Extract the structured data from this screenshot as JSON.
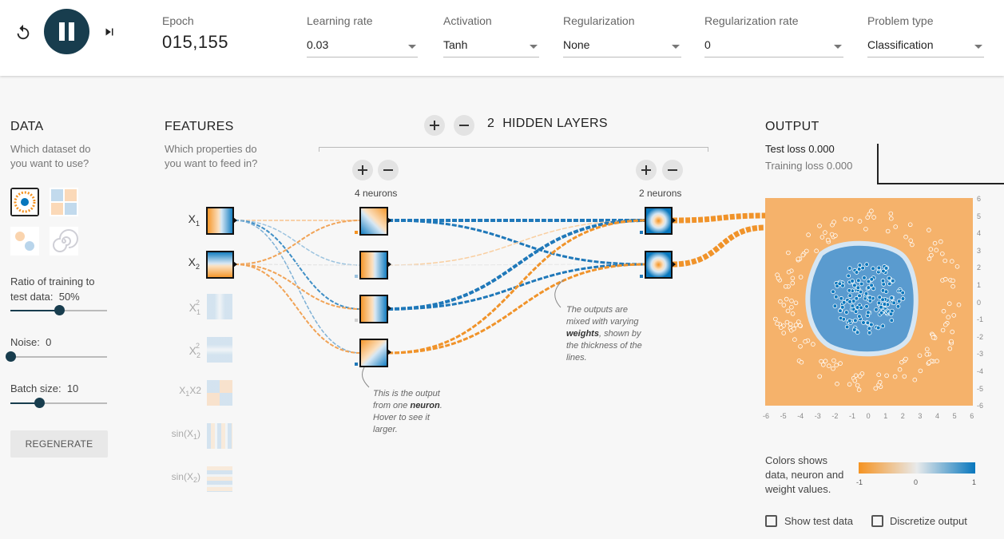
{
  "controls": {
    "reset": "reset-icon",
    "play": "pause-icon",
    "step": "step-forward-icon"
  },
  "epoch": {
    "label": "Epoch",
    "value": "015,155"
  },
  "selects": [
    {
      "label": "Learning rate",
      "value": "0.03"
    },
    {
      "label": "Activation",
      "value": "Tanh"
    },
    {
      "label": "Regularization",
      "value": "None"
    },
    {
      "label": "Regularization rate",
      "value": "0"
    },
    {
      "label": "Problem type",
      "value": "Classification"
    }
  ],
  "data": {
    "title": "DATA",
    "subtitle": "Which dataset do you want to use?",
    "datasets": [
      "circle",
      "xor",
      "gaussian",
      "spiral"
    ],
    "ratio_label": "Ratio of training to test data:",
    "ratio_value": "50%",
    "ratio_level": 0.5,
    "noise_label": "Noise:",
    "noise_value": "0",
    "noise_level": 0,
    "batch_label": "Batch size:",
    "batch_value": "10",
    "batch_level": 0.3,
    "regenerate": "REGENERATE"
  },
  "features": {
    "title": "FEATURES",
    "subtitle": "Which properties do you want to feed in?",
    "items": [
      {
        "base": "X",
        "sub": "1",
        "sup": "",
        "suffix": "",
        "active": true
      },
      {
        "base": "X",
        "sub": "2",
        "sup": "",
        "suffix": "",
        "active": true
      },
      {
        "base": "X",
        "sub": "1",
        "sup": "2",
        "suffix": "",
        "active": false
      },
      {
        "base": "X",
        "sub": "2",
        "sup": "2",
        "suffix": "",
        "active": false
      },
      {
        "base": "X",
        "sub": "1",
        "sup": "",
        "suffix": "X2",
        "active": false
      },
      {
        "base": "sin(X",
        "sub": "1",
        "sup": "",
        "suffix": ")",
        "active": false
      },
      {
        "base": "sin(X",
        "sub": "2",
        "sup": "",
        "suffix": ")",
        "active": false
      }
    ]
  },
  "hidden": {
    "count": "2",
    "label": "HIDDEN LAYERS",
    "layer1_neurons": "4 neurons",
    "layer2_neurons": "2 neurons"
  },
  "annotations": {
    "neuron_pre": "This is the output from one ",
    "neuron_bold": "neuron",
    "neuron_post": ". Hover to see it larger.",
    "weights_pre": "The outputs are mixed with varying ",
    "weights_bold": "weights",
    "weights_post": ", shown by the thickness of the lines."
  },
  "output": {
    "title": "OUTPUT",
    "test_loss_label": "Test loss",
    "test_loss_value": "0.000",
    "training_loss_label": "Training loss",
    "training_loss_value": "0.000",
    "y_ticks": [
      "6",
      "5",
      "4",
      "3",
      "2",
      "1",
      "0",
      "-1",
      "-2",
      "-3",
      "-4",
      "-5",
      "-6"
    ],
    "x_ticks": [
      "-6",
      "-5",
      "-4",
      "-3",
      "-2",
      "-1",
      "0",
      "1",
      "2",
      "3",
      "4",
      "5",
      "6"
    ],
    "legend_text": "Colors shows data, neuron and weight values.",
    "legend_min": "-1",
    "legend_mid": "0",
    "legend_max": "1",
    "show_test_label": "Show test data",
    "discretize_label": "Discretize output"
  },
  "colors": {
    "orange": "#f59322",
    "blue": "#0877bd",
    "dark": "#183d4e",
    "orange_bg": "#f5b26b"
  }
}
